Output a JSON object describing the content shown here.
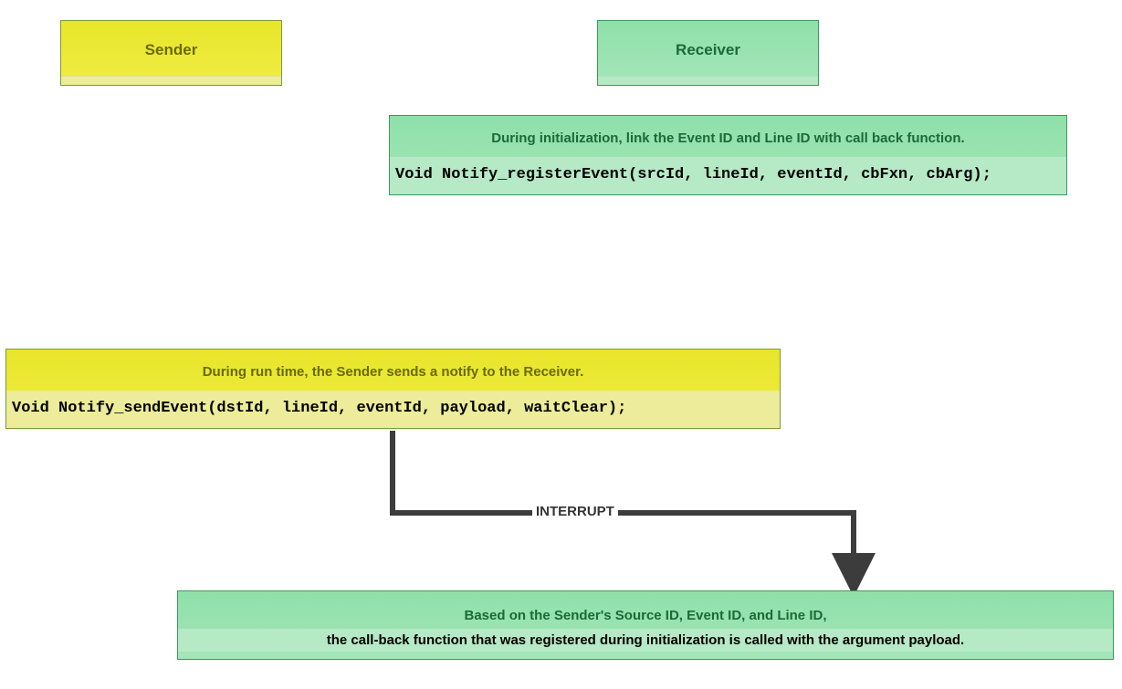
{
  "sender": {
    "label": "Sender"
  },
  "receiver": {
    "label": "Receiver"
  },
  "init_box": {
    "desc": "During initialization, link the Event ID and Line ID with call back function.",
    "code": "Void Notify_registerEvent(srcId, lineId, eventId, cbFxn, cbArg);"
  },
  "runtime_box": {
    "desc": "During run time, the Sender sends a notify to the Receiver.",
    "code": "Void Notify_sendEvent(dstId, lineId, eventId, payload, waitClear);"
  },
  "interrupt_label": "INTERRUPT",
  "result_box": {
    "line1": "Based on the Sender's Source ID, Event ID, and Line ID,",
    "line2": "the call-back function that was registered during initialization is called with the argument payload."
  },
  "colors": {
    "yellow": "#e8e52a",
    "yellow_light": "#ecec9a",
    "green": "#8fe0a9",
    "green_light": "#b6e9c5",
    "arrow": "#3c3c3c"
  }
}
